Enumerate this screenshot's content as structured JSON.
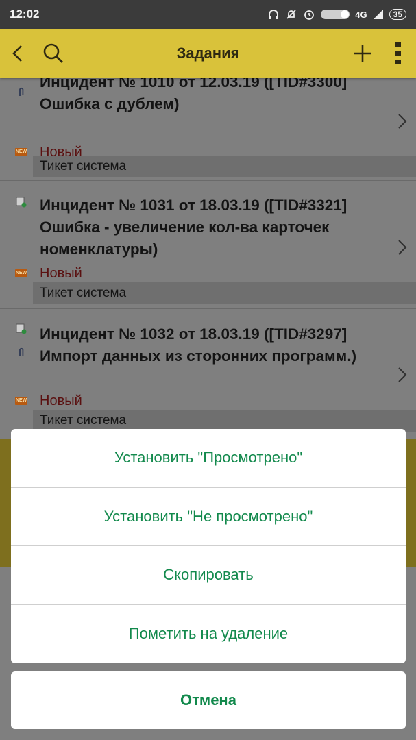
{
  "status_bar": {
    "time": "12:02",
    "network": "4G",
    "battery": "35"
  },
  "toolbar": {
    "title": "Задания",
    "icons": [
      "back-arrow-icon",
      "search-icon",
      "plus-icon",
      "more-vert-icon"
    ]
  },
  "tasks": [
    {
      "title": "Инцидент  № 1010 от 12.03.19 ([TID#3300] Ошибка с дублем)",
      "status": "Новый",
      "type": "Тикет система"
    },
    {
      "title": "Инцидент  № 1031 от 18.03.19 ([TID#3321] Ошибка - увеличение кол-ва карточек номенклатуры)",
      "status": "Новый",
      "type": "Тикет система"
    },
    {
      "title": "Инцидент  № 1032 от 18.03.19 ([TID#3297] Импорт данных из сторонних программ.)",
      "status": "Новый",
      "type": "Тикет система"
    }
  ],
  "action_sheet": {
    "items": [
      "Установить \"Просмотрено\"",
      "Установить \"Не просмотрено\"",
      "Скопировать",
      "Пометить на удаление"
    ],
    "cancel": "Отмена"
  },
  "colors": {
    "toolbar": "#d9c23a",
    "action_text": "#12894c",
    "status_text": "#5a1010"
  }
}
